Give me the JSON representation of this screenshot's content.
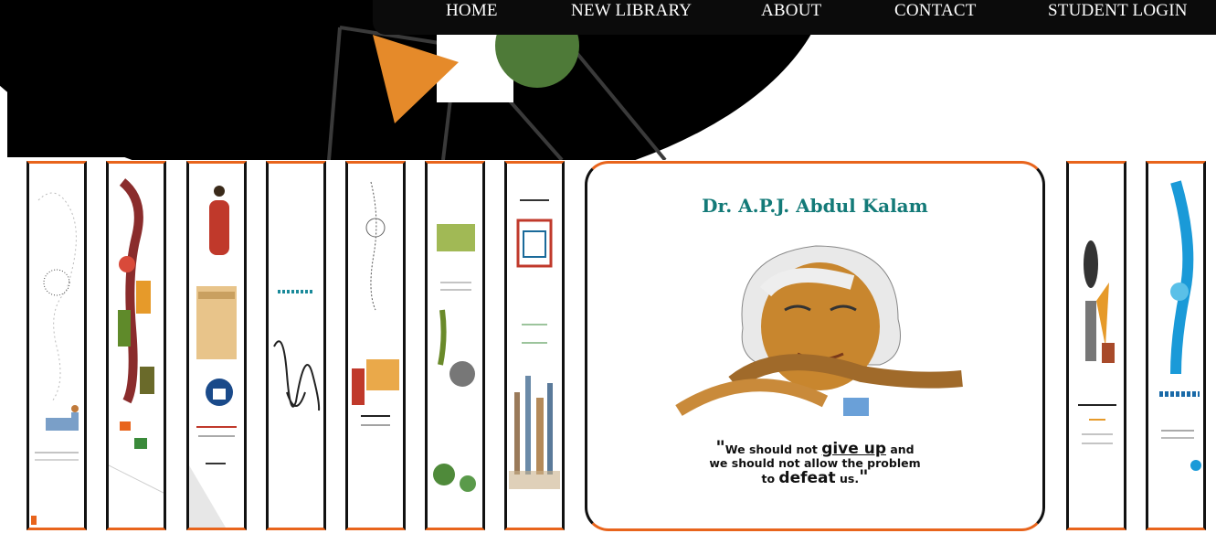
{
  "nav": {
    "items": [
      {
        "label": "HOME"
      },
      {
        "label": "NEW LIBRARY"
      },
      {
        "label": "ABOUT"
      },
      {
        "label": "CONTACT"
      },
      {
        "label": "STUDENT LOGIN"
      }
    ]
  },
  "featured": {
    "title": "Dr. A.P.J. Abdul Kalam",
    "quote_line1_pre": "We should not ",
    "quote_line1_big": "give up",
    "quote_line1_post": " and",
    "quote_line2": "we should not allow the problem",
    "quote_line3_pre": "to ",
    "quote_line3_big": "defeat",
    "quote_line3_post": " us."
  },
  "colors": {
    "nav_bg": "#0b0b0b",
    "accent_orange": "#e8641c",
    "title_teal": "#137a78",
    "shape_orange": "#e58a2a",
    "shape_green": "#4e7a38"
  }
}
